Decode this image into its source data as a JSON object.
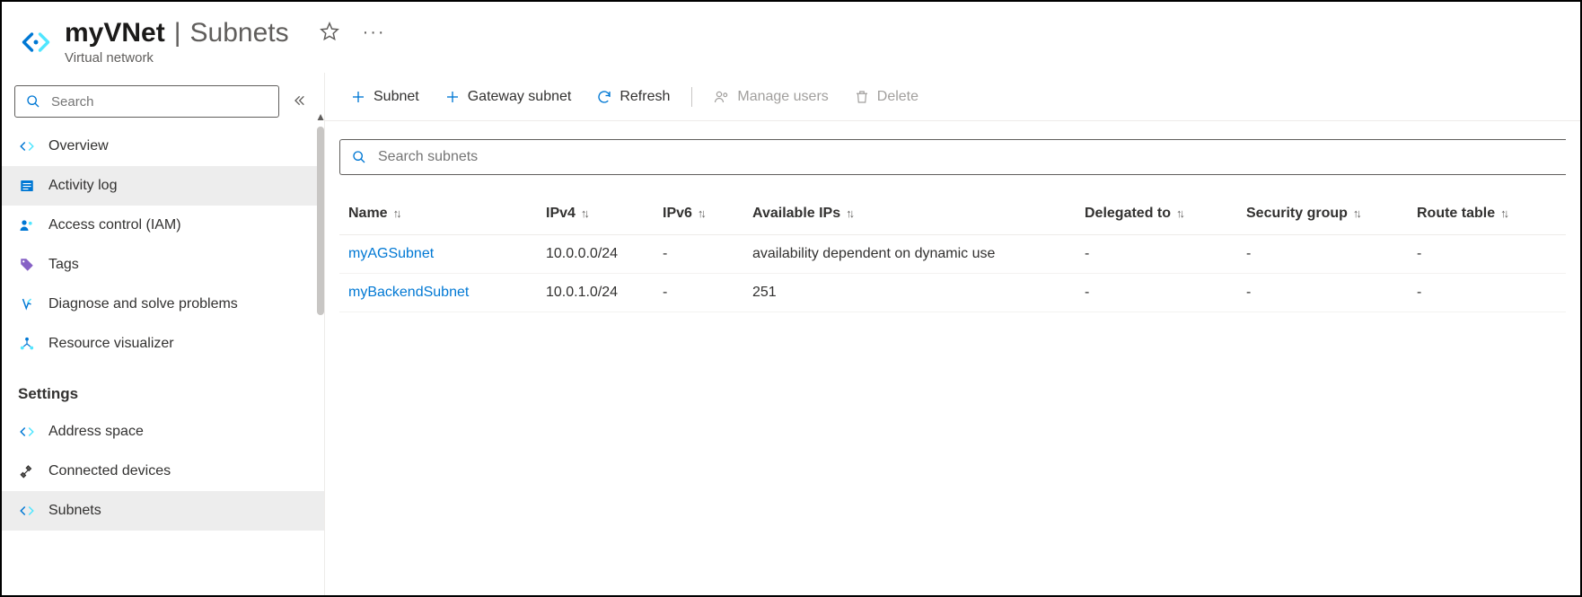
{
  "header": {
    "resource_name": "myVNet",
    "page_title": "Subnets",
    "resource_type": "Virtual network"
  },
  "sidebar": {
    "search_placeholder": "Search",
    "items": [
      {
        "label": "Overview"
      },
      {
        "label": "Activity log"
      },
      {
        "label": "Access control (IAM)"
      },
      {
        "label": "Tags"
      },
      {
        "label": "Diagnose and solve problems"
      },
      {
        "label": "Resource visualizer"
      }
    ],
    "section_header": "Settings",
    "settings_items": [
      {
        "label": "Address space"
      },
      {
        "label": "Connected devices"
      },
      {
        "label": "Subnets"
      }
    ]
  },
  "toolbar": {
    "add_subnet": "Subnet",
    "add_gateway": "Gateway subnet",
    "refresh": "Refresh",
    "manage_users": "Manage users",
    "delete": "Delete"
  },
  "subnet_search_placeholder": "Search subnets",
  "columns": {
    "name": "Name",
    "ipv4": "IPv4",
    "ipv6": "IPv6",
    "available": "Available IPs",
    "delegated": "Delegated to",
    "security": "Security group",
    "route": "Route table"
  },
  "rows": [
    {
      "name": "myAGSubnet",
      "ipv4": "10.0.0.0/24",
      "ipv6": "-",
      "available": "availability dependent on dynamic use",
      "delegated": "-",
      "security": "-",
      "route": "-"
    },
    {
      "name": "myBackendSubnet",
      "ipv4": "10.0.1.0/24",
      "ipv6": "-",
      "available": "251",
      "delegated": "-",
      "security": "-",
      "route": "-"
    }
  ]
}
